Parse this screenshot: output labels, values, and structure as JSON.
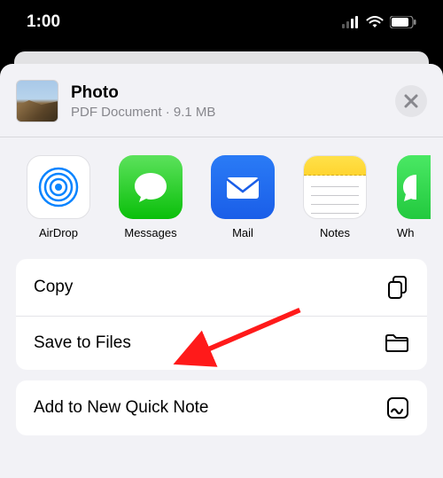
{
  "status": {
    "time": "1:00"
  },
  "doc": {
    "title": "Photo",
    "subtitle": "PDF Document · 9.1 MB"
  },
  "apps": {
    "airdrop": "AirDrop",
    "messages": "Messages",
    "mail": "Mail",
    "notes": "Notes",
    "whatsapp": "Wh"
  },
  "actions": {
    "copy": "Copy",
    "saveFiles": "Save to Files",
    "quickNote": "Add to New Quick Note"
  }
}
